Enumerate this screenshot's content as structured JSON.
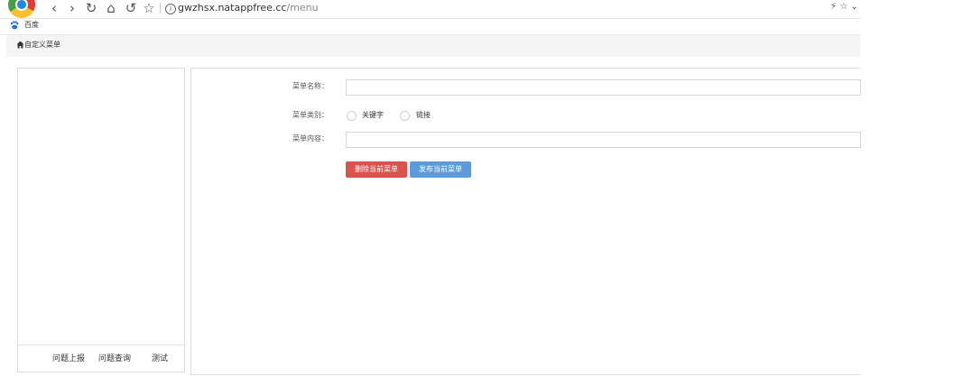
{
  "browser": {
    "nav": {
      "back_glyph": "‹",
      "forward_glyph": "›",
      "reload_glyph": "↻",
      "home_glyph": "⌂",
      "undo_glyph": "↺",
      "bookmark_glyph": "☆"
    },
    "url_host": "gwzhsx.natappfree.cc",
    "url_path": "/menu",
    "right_icons": "⚡ ☆ ⌄",
    "bookmarks": [
      {
        "label": "百度",
        "icon": "baidu-icon"
      }
    ]
  },
  "breadcrumb": {
    "icon": "home-icon",
    "label": "自定义菜单"
  },
  "preview": {
    "menu_tabs": [
      "问题上报",
      "问题查询",
      "测试"
    ]
  },
  "form": {
    "name_label": "菜单名称：",
    "name_value": "",
    "type_label": "菜单类别：",
    "type_options": [
      "关键字",
      "链接"
    ],
    "content_label": "菜单内容：",
    "content_value": "",
    "delete_button": "删除当前菜单",
    "publish_button": "发布当前菜单"
  },
  "colors": {
    "delete_button": "#d9534f",
    "publish_button": "#5b9bdc"
  }
}
